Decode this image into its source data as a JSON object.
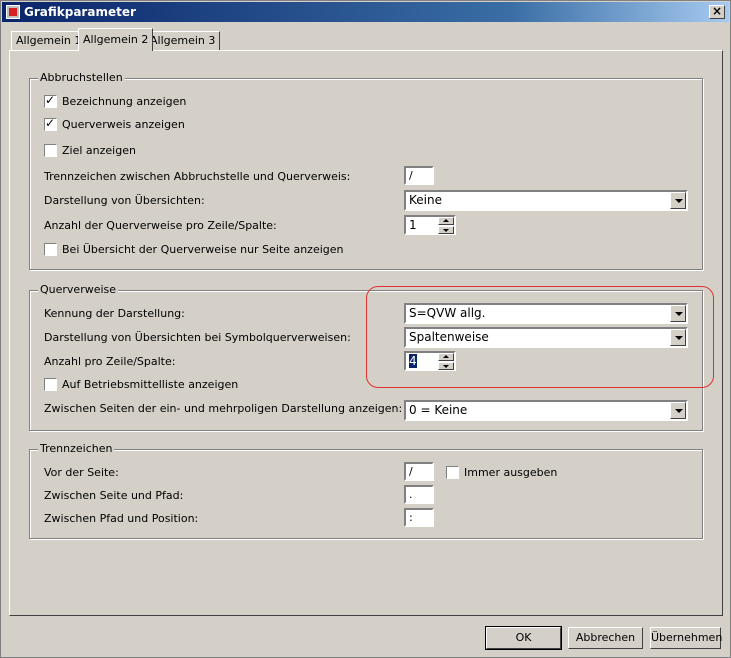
{
  "window": {
    "title": "Grafikparameter",
    "close_label": "×"
  },
  "tabs": [
    {
      "label": "Allgemein 1"
    },
    {
      "label": "Allgemein 2"
    },
    {
      "label": "Allgemein 3"
    }
  ],
  "abbruchstellen": {
    "title": "Abbruchstellen",
    "bezeichnung_label": "Bezeichnung anzeigen",
    "bezeichnung_checked": true,
    "querverweis_label": "Querverweis anzeigen",
    "querverweis_checked": true,
    "ziel_label": "Ziel anzeigen",
    "ziel_checked": false,
    "trennzeichen_label": "Trennzeichen zwischen Abbruchstelle und Querverweis:",
    "trennzeichen_value": "/",
    "darstellung_label": "Darstellung von Übersichten:",
    "darstellung_value": "Keine",
    "anzahl_label": "Anzahl der Querverweise pro Zeile/Spalte:",
    "anzahl_value": "1",
    "uebersicht_label": "Bei Übersicht der Querverweise nur Seite anzeigen",
    "uebersicht_checked": false
  },
  "querverweise": {
    "title": "Querverweise",
    "kennung_label": "Kennung der Darstellung:",
    "kennung_value": "S=QVW allg.",
    "darstellung_label": "Darstellung von Übersichten bei Symbolquerverweisen:",
    "darstellung_value": "Spaltenweise",
    "anzahl_label": "Anzahl pro Zeile/Spalte:",
    "anzahl_value": "4",
    "betriebsmittel_label": "Auf Betriebsmittelliste anzeigen",
    "betriebsmittel_checked": false,
    "zwischen_label": "Zwischen Seiten der ein- und mehrpoligen Darstellung anzeigen:",
    "zwischen_value": "0 = Keine"
  },
  "trennzeichen": {
    "title": "Trennzeichen",
    "vor_label": "Vor der Seite:",
    "vor_value": "/",
    "immer_label": "Immer ausgeben",
    "immer_checked": false,
    "seite_pfad_label": "Zwischen Seite und Pfad:",
    "seite_pfad_value": ".",
    "pfad_position_label": "Zwischen Pfad und Position:",
    "pfad_position_value": ":"
  },
  "buttons": {
    "ok": "OK",
    "abbrechen": "Abbrechen",
    "uebernehmen": "Übernehmen"
  },
  "colors": {
    "titlebar": "#0a246a",
    "highlight": "#e03030",
    "face": "#d4d0c8"
  }
}
